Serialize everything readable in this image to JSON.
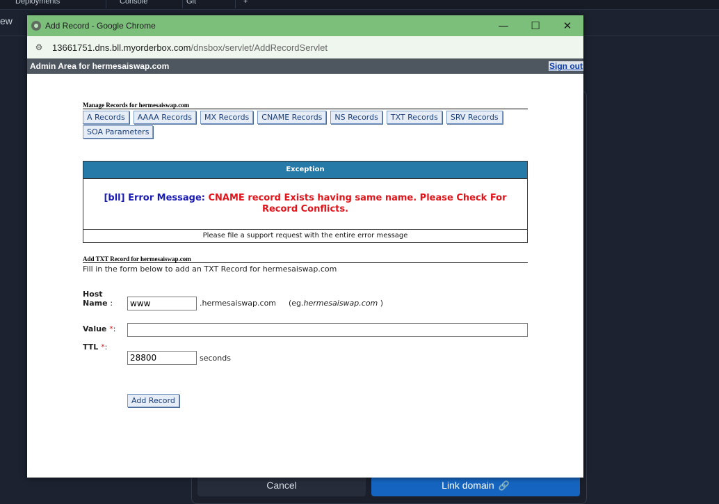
{
  "background": {
    "tabs": [
      "Deployments",
      "Console",
      "Git",
      "+"
    ],
    "sidebar_text": "ew",
    "cancel_label": "Cancel",
    "link_domain_label": "Link domain"
  },
  "window": {
    "title": "Add Record - Google Chrome",
    "url_host": "13661751.dns.bll.myorderbox.com",
    "url_path": "/dnsbox/servlet/AddRecordServlet"
  },
  "admin": {
    "title": "Admin Area for hermesaiswap.com",
    "signout": "Sign out"
  },
  "manage": {
    "title": "Manage Records for hermesaiswap.com",
    "buttons": [
      "A Records",
      "AAAA Records",
      "MX Records",
      "CNAME Records",
      "NS Records",
      "TXT Records",
      "SRV Records",
      "SOA Parameters"
    ]
  },
  "exception": {
    "header": "Exception",
    "label": "[bll] Error Message:",
    "message": "CNAME record Exists having same name. Please Check For Record Conflicts.",
    "footer": "Please file a support request with the entire error message"
  },
  "form": {
    "title": "Add TXT Record for hermesaiswap.com",
    "subtitle": "Fill in the form below to add an TXT Record for hermesaiswap.com",
    "host_label_line1": "Host",
    "host_label_line2": "Name",
    "host_colon": ":",
    "host_value": "www",
    "host_suffix": ".hermesaiswap.com",
    "host_example_prefix": "(eg.",
    "host_example_domain": "hermesaiswap.com",
    "host_example_suffix": " )",
    "value_label": "Value",
    "value_value": "",
    "ttl_label": "TTL",
    "required_mark": "*",
    "colon": ":",
    "ttl_value": "28800",
    "ttl_unit": "seconds",
    "submit_label": "Add Record"
  }
}
